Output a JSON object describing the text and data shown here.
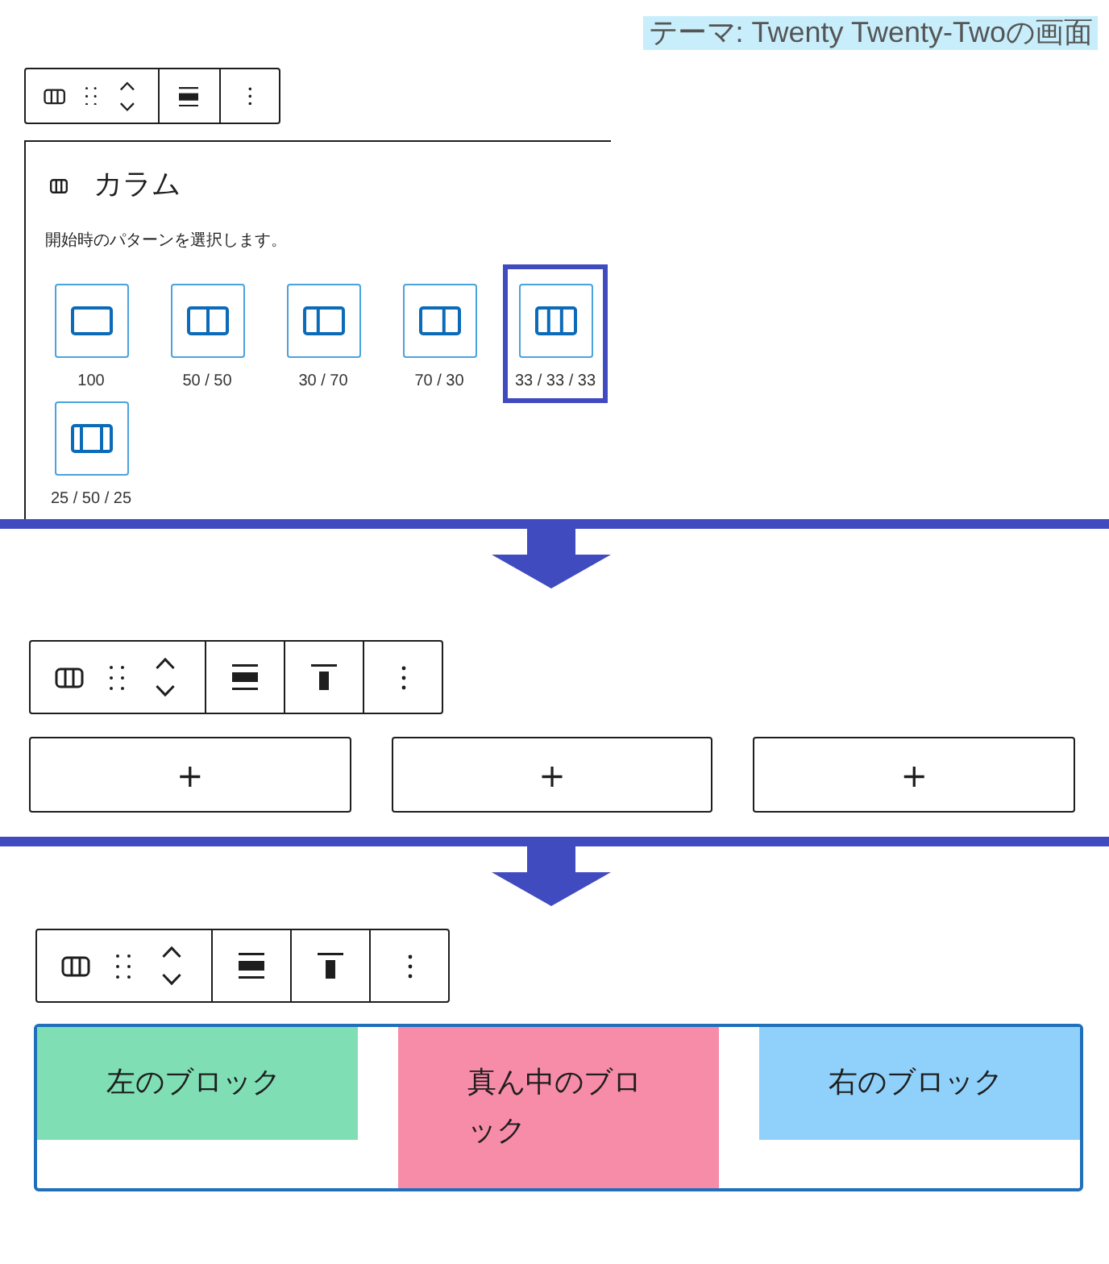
{
  "caption": {
    "text": "テーマ: Twenty Twenty-Twoの画面"
  },
  "steps": [
    {
      "kind": "placeholder",
      "toolbar": {
        "groups": [
          {
            "tools": [
              {
                "kind": "block-type"
              },
              {
                "kind": "drag"
              },
              {
                "kind": "move"
              }
            ]
          },
          {
            "tools": [
              {
                "kind": "align"
              }
            ]
          },
          {
            "tools": [
              {
                "kind": "more"
              }
            ]
          }
        ]
      },
      "placeholder": {
        "title": "カラム",
        "instructions": "開始時のパターンを選択します。",
        "variations": [
          {
            "label": "100",
            "kind": "single",
            "selected": false
          },
          {
            "label": "50 / 50",
            "kind": "halves",
            "selected": false
          },
          {
            "label": "30 / 70",
            "kind": "narrow-wide",
            "selected": false
          },
          {
            "label": "70 / 30",
            "kind": "wide-narrow",
            "selected": false
          },
          {
            "label": "33 / 33 / 33",
            "kind": "thirds",
            "selected": true
          },
          {
            "label": "25 / 50 / 25",
            "kind": "wide-center",
            "selected": false
          }
        ]
      }
    },
    {
      "kind": "empty-columns",
      "toolbar": {
        "groups": [
          {
            "tools": [
              {
                "kind": "block-type"
              },
              {
                "kind": "drag"
              },
              {
                "kind": "move"
              }
            ]
          },
          {
            "tools": [
              {
                "kind": "align"
              }
            ]
          },
          {
            "tools": [
              {
                "kind": "vertical-align"
              }
            ]
          },
          {
            "tools": [
              {
                "kind": "more"
              }
            ]
          }
        ]
      },
      "columns": [
        {
          "button": "+"
        },
        {
          "button": "+"
        },
        {
          "button": "+"
        }
      ]
    },
    {
      "kind": "filled-columns",
      "toolbar": {
        "groups": [
          {
            "tools": [
              {
                "kind": "block-type"
              },
              {
                "kind": "drag"
              },
              {
                "kind": "move"
              }
            ]
          },
          {
            "tools": [
              {
                "kind": "align"
              }
            ]
          },
          {
            "tools": [
              {
                "kind": "vertical-align"
              }
            ]
          },
          {
            "tools": [
              {
                "kind": "more"
              }
            ]
          }
        ]
      },
      "columns": [
        {
          "text": "左のブロック",
          "color": "#80deb5"
        },
        {
          "text": "真ん中のブロック",
          "color": "#f78ca8"
        },
        {
          "text": "右のブロック",
          "color": "#90d1fb"
        }
      ]
    }
  ]
}
